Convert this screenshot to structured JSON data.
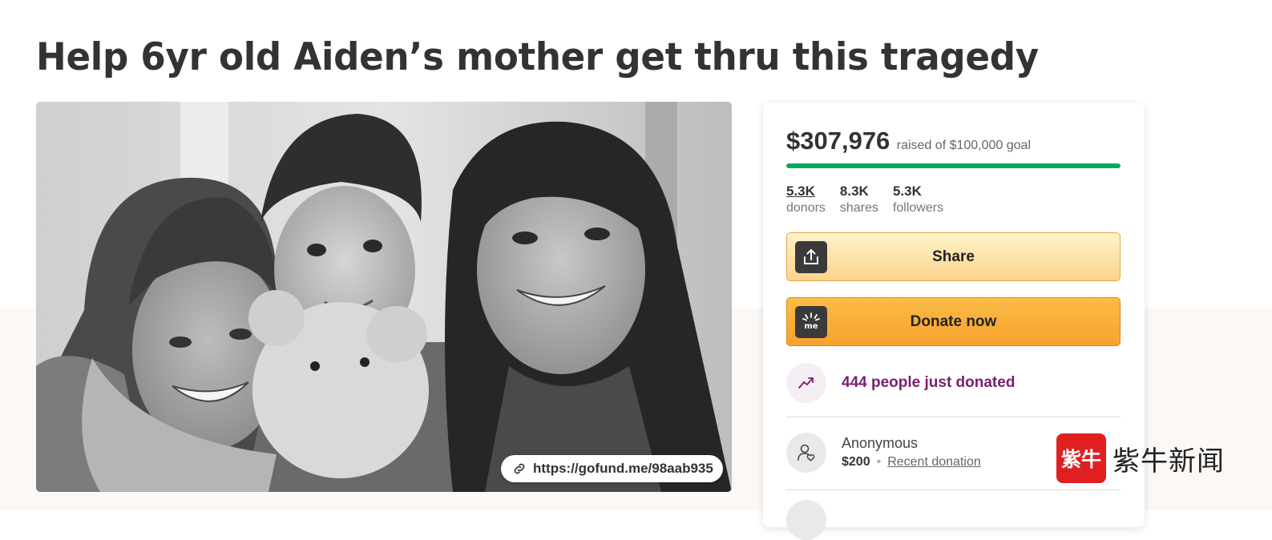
{
  "page": {
    "title": "Help 6yr old Aiden’s mother get thru this tragedy"
  },
  "hero": {
    "image_alt": "Black and white photo of a woman, a young boy holding a teddy bear, and a teenage girl smiling",
    "url": "https://gofund.me/98aab935",
    "link_icon": "link-icon"
  },
  "campaign": {
    "raised_amount": "$307,976",
    "raised_text": "raised of $100,000 goal",
    "progress_fraction": 1.0,
    "progress_color": "#02a95c",
    "stats": [
      {
        "value": "5.3K",
        "label": "donors",
        "underline": true
      },
      {
        "value": "8.3K",
        "label": "shares",
        "underline": false
      },
      {
        "value": "5.3K",
        "label": "followers",
        "underline": false
      }
    ],
    "share_label": "Share",
    "share_icon": "share-upload-icon",
    "donate_label": "Donate now",
    "donate_icon": "gofundme-logo-icon",
    "trend_icon": "trending-up-icon",
    "trend_text": "444 people just donated",
    "trend_color": "#7a1f6e",
    "donations": [
      {
        "name": "Anonymous",
        "amount": "$200",
        "tag": "Recent donation",
        "icon": "donor-heart-icon"
      }
    ]
  },
  "watermark": {
    "logo_text": "紫牛",
    "text": "紫牛新闻",
    "color": "#e02020"
  }
}
